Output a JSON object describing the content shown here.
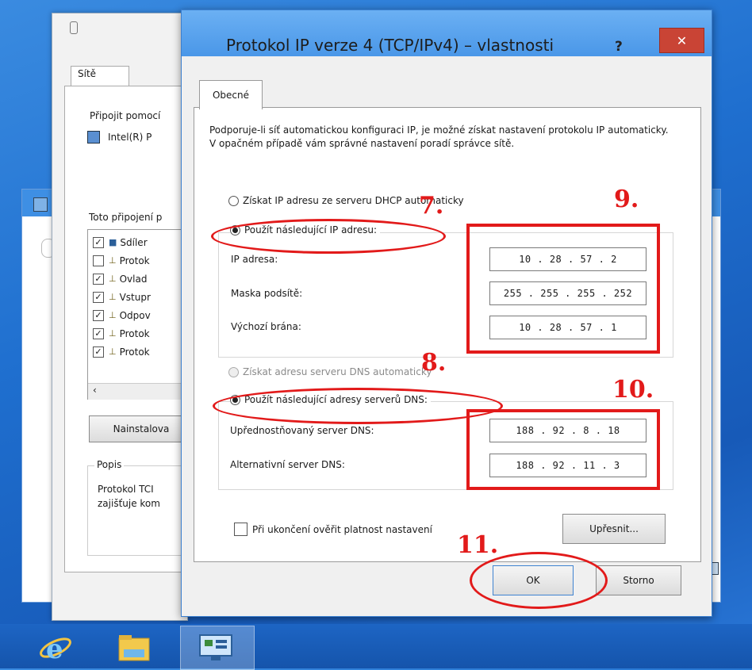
{
  "background_window": {
    "tab_label": "Sítě",
    "connect_label": "Připojit pomocí",
    "adapter": "Intel(R) P",
    "uses_label": "Toto připojení p",
    "items": [
      {
        "checked": true,
        "label": "Sdíler"
      },
      {
        "checked": false,
        "label": "Protok"
      },
      {
        "checked": true,
        "label": "Ovlad"
      },
      {
        "checked": true,
        "label": "Vstupr"
      },
      {
        "checked": true,
        "label": "Odpov"
      },
      {
        "checked": true,
        "label": "Protok"
      },
      {
        "checked": true,
        "label": "Protok"
      }
    ],
    "install_button": "Nainstalova",
    "description_heading": "Popis",
    "description_text_1": "Protokol TCI",
    "description_text_2": "zajišťuje kom"
  },
  "dialog": {
    "title": "Protokol IP verze 4 (TCP/IPv4) – vlastnosti",
    "help": "?",
    "close": "✕",
    "tab": "Obecné",
    "description": "Podporuje-li síť automatickou konfiguraci IP, je možné získat nastavení protokolu IP automaticky. V opačném případě vám správné nastavení poradí správce sítě.",
    "ip_auto_label": "Získat IP adresu ze serveru DHCP automaticky",
    "ip_manual_label": "Použít následující IP adresu:",
    "ip_address_label": "IP adresa:",
    "ip_address_value": "10 . 28 . 57 . 2",
    "subnet_label": "Maska podsítě:",
    "subnet_value": "255 . 255 . 255 . 252",
    "gateway_label": "Výchozí brána:",
    "gateway_value": "10 . 28 . 57 . 1",
    "dns_auto_label": "Získat adresu serveru DNS automaticky",
    "dns_manual_label": "Použít následující adresy serverů DNS:",
    "dns_pref_label": "Upřednostňovaný server DNS:",
    "dns_pref_value": "188 . 92 . 8 . 18",
    "dns_alt_label": "Alternativní server DNS:",
    "dns_alt_value": "188 . 92 . 11 . 3",
    "validate_label": "Při ukončení ověřit platnost nastavení",
    "advanced_button": "Upřesnit...",
    "ok_button": "OK",
    "cancel_button": "Storno"
  },
  "annotations": {
    "step7": "7.",
    "step8": "8.",
    "step9": "9.",
    "step10": "10.",
    "step11": "11."
  },
  "colors": {
    "annotation_red": "#e21a1a",
    "taskbar": "#1d65c4",
    "title_bar": "#4a97e8",
    "close_button": "#c94435"
  },
  "taskbar": {
    "icons": [
      "internet-explorer-icon",
      "file-explorer-icon",
      "control-panel-icon"
    ]
  }
}
